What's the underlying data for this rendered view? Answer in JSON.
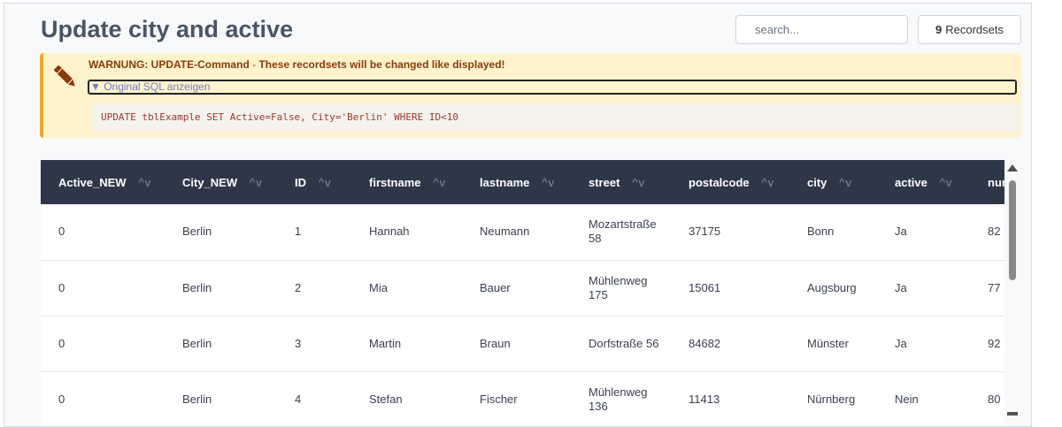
{
  "page": {
    "title": "Update city and active"
  },
  "search": {
    "placeholder": "search..."
  },
  "recordsets": {
    "count": "9",
    "label": "Recordsets"
  },
  "warning": {
    "strong": "WARNUNG: UPDATE-Command",
    "dash": " - ",
    "text": "These recordsets will be changed like displayed!",
    "details_label": "▼ Original SQL anzeigen",
    "sql": "UPDATE tblExample SET Active=False, City='Berlin' WHERE ID<10"
  },
  "sort_glyph": "^v",
  "table": {
    "columns": [
      "Active_NEW",
      "City_NEW",
      "ID",
      "firstname",
      "lastname",
      "street",
      "postalcode",
      "city",
      "active",
      "number"
    ],
    "rows": [
      [
        "0",
        "Berlin",
        "1",
        "Hannah",
        "Neumann",
        "Mozartstraße 58",
        "37175",
        "Bonn",
        "Ja",
        "82"
      ],
      [
        "0",
        "Berlin",
        "2",
        "Mia",
        "Bauer",
        "Mühlenweg 175",
        "15061",
        "Augsburg",
        "Ja",
        "77"
      ],
      [
        "0",
        "Berlin",
        "3",
        "Martin",
        "Braun",
        "Dorfstraße 56",
        "84682",
        "Münster",
        "Ja",
        "92"
      ],
      [
        "0",
        "Berlin",
        "4",
        "Stefan",
        "Fischer",
        "Mühlenweg 136",
        "11413",
        "Nürnberg",
        "Nein",
        "80"
      ]
    ]
  },
  "colors": {
    "header_bg": "#2e3748",
    "warning_bg": "#fff3cd",
    "warning_border": "#f5a524",
    "warning_text": "#8a3b0a",
    "sql_text": "#a0392f"
  }
}
